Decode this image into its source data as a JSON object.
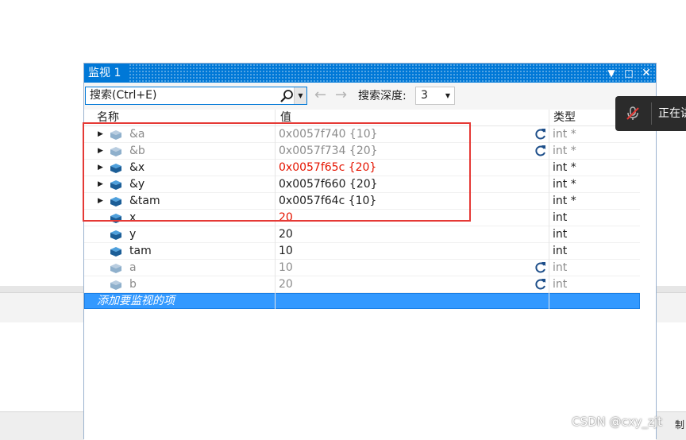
{
  "panel": {
    "title": "监视 1",
    "buttons": {
      "dropdown": "▼",
      "maximize": "□",
      "close": "✕"
    }
  },
  "toolbar": {
    "search_value": "搜索(Ctrl+E)",
    "back_arrow": "←",
    "forward_arrow": "→",
    "depth_label": "搜索深度:",
    "depth_value": "3"
  },
  "columns": {
    "name": "名称",
    "value": "值",
    "type": "类型"
  },
  "rows": [
    {
      "name": "&a",
      "value": "0x0057f740 {10}",
      "type": "int *",
      "expandable": true,
      "stale": true,
      "refresh": true,
      "changed": false
    },
    {
      "name": "&b",
      "value": "0x0057f734 {20}",
      "type": "int *",
      "expandable": true,
      "stale": true,
      "refresh": true,
      "changed": false
    },
    {
      "name": "&x",
      "value": "0x0057f65c {20}",
      "type": "int *",
      "expandable": true,
      "stale": false,
      "refresh": false,
      "changed": true
    },
    {
      "name": "&y",
      "value": "0x0057f660 {20}",
      "type": "int *",
      "expandable": true,
      "stale": false,
      "refresh": false,
      "changed": false
    },
    {
      "name": "&tam",
      "value": "0x0057f64c {10}",
      "type": "int *",
      "expandable": true,
      "stale": false,
      "refresh": false,
      "changed": false
    },
    {
      "name": "x",
      "value": "20",
      "type": "int",
      "expandable": false,
      "stale": false,
      "refresh": false,
      "changed": true
    },
    {
      "name": "y",
      "value": "20",
      "type": "int",
      "expandable": false,
      "stale": false,
      "refresh": false,
      "changed": false
    },
    {
      "name": "tam",
      "value": "10",
      "type": "int",
      "expandable": false,
      "stale": false,
      "refresh": false,
      "changed": false
    },
    {
      "name": "a",
      "value": "10",
      "type": "int",
      "expandable": false,
      "stale": true,
      "refresh": true,
      "changed": false
    },
    {
      "name": "b",
      "value": "20",
      "type": "int",
      "expandable": false,
      "stale": true,
      "refresh": true,
      "changed": false
    }
  ],
  "add_watch_placeholder": "添加要监视的项",
  "notification": {
    "text": "正在讲",
    "icon": "mic-muted-icon"
  },
  "watermark": {
    "text": "CSDN @cxy_zjt",
    "suffix": "制"
  },
  "colors": {
    "accent": "#0078d7",
    "changed_value": "#e51400",
    "stale_text": "#8c8c8c",
    "selection": "#3399ff",
    "highlight_box": "#e53935"
  },
  "icons": {
    "expand": "triangle-right-icon",
    "variable": "variable-cube-icon",
    "refresh": "refresh-icon",
    "search": "search-icon"
  }
}
